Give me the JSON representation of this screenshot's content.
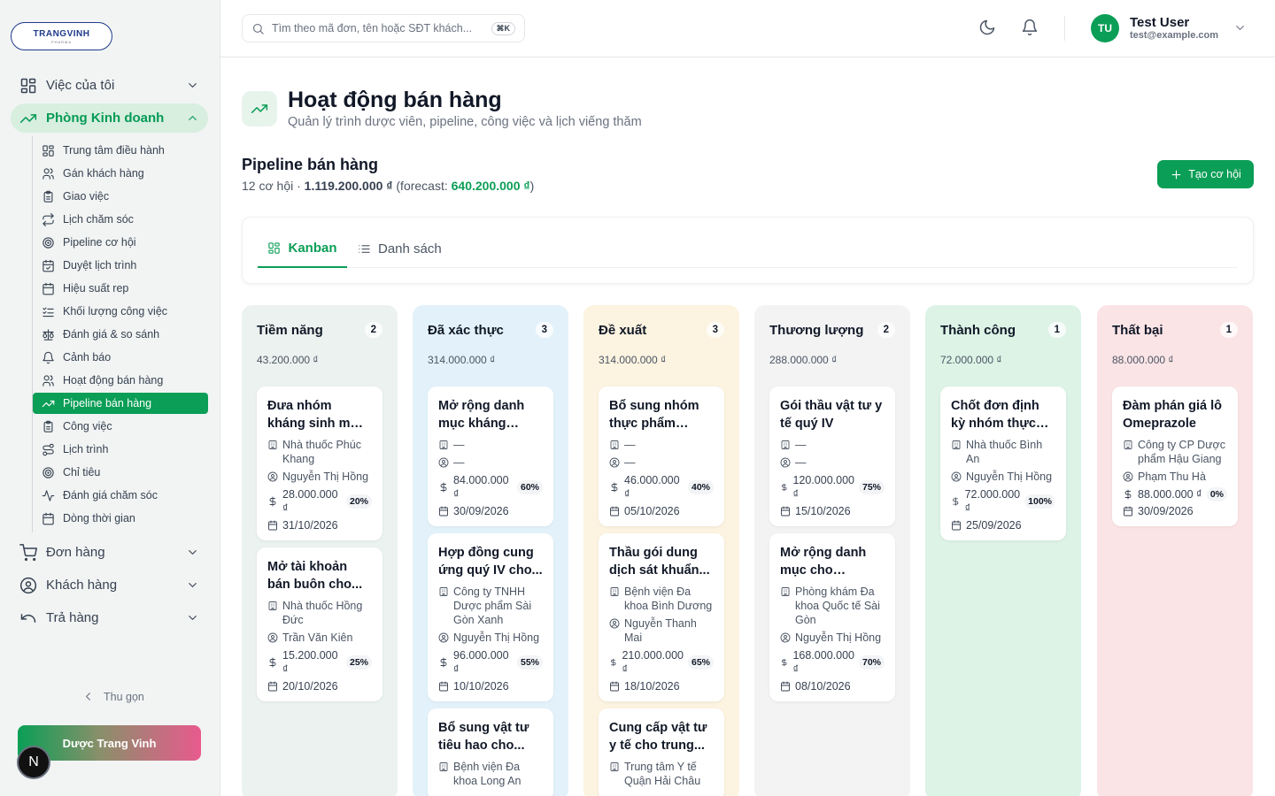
{
  "brand": {
    "logo_main": "TRANGVINH",
    "logo_sub": "PHARMA",
    "footer_name": "Dược Trang Vinh",
    "n_badge": "N"
  },
  "sidebar": {
    "groups": [
      {
        "label": "Việc của tôi"
      },
      {
        "label": "Phòng Kinh doanh"
      },
      {
        "label": "Đơn hàng"
      },
      {
        "label": "Khách hàng"
      },
      {
        "label": "Trả hàng"
      }
    ],
    "sub_items": [
      {
        "label": "Trung tâm điều hành"
      },
      {
        "label": "Gán khách hàng"
      },
      {
        "label": "Giao việc"
      },
      {
        "label": "Lịch chăm sóc"
      },
      {
        "label": "Pipeline cơ hội"
      },
      {
        "label": "Duyệt lịch trình"
      },
      {
        "label": "Hiệu suất rep"
      },
      {
        "label": "Khối lượng công việc"
      },
      {
        "label": "Đánh giá & so sánh"
      },
      {
        "label": "Cảnh báo"
      },
      {
        "label": "Hoạt động bán hàng"
      },
      {
        "label": "Pipeline bán hàng"
      },
      {
        "label": "Công việc"
      },
      {
        "label": "Lịch trình"
      },
      {
        "label": "Chỉ tiêu"
      },
      {
        "label": "Đánh giá chăm sóc"
      },
      {
        "label": "Dòng thời gian"
      }
    ],
    "collapse_label": "Thu gọn"
  },
  "header": {
    "search_placeholder": "Tìm theo mã đơn, tên hoặc SĐT khách...",
    "search_shortcut": "⌘K",
    "user_initials": "TU",
    "user_name": "Test User",
    "user_email": "test@example.com"
  },
  "page": {
    "title": "Hoạt động bán hàng",
    "subtitle": "Quản lý trình dược viên, pipeline, công việc và lịch viếng thăm",
    "section_title": "Pipeline bán hàng",
    "summary_prefix": "12 cơ hội · ",
    "summary_total": "1.119.200.000 ₫",
    "summary_mid": " (forecast: ",
    "summary_forecast": "640.200.000 ₫",
    "summary_suffix": ")",
    "create_button": "Tạo cơ hội",
    "tab_kanban": "Kanban",
    "tab_list": "Danh sách"
  },
  "colors": {
    "accent": "#0b9e56"
  },
  "columns": [
    {
      "title": "Tiềm năng",
      "count": "2",
      "total": "43.200.000 ₫",
      "bg": "#ebf2ef",
      "cards": [
        {
          "title": "Đưa nhóm kháng sinh mới vào...",
          "customer": "Nhà thuốc Phúc Khang",
          "rep": "Nguyễn Thị Hồng",
          "amount": "28.000.000 ₫",
          "pct": "20%",
          "date": "31/10/2026"
        },
        {
          "title": "Mở tài khoản bán buôn cho...",
          "customer": "Nhà thuốc Hồng Đức",
          "rep": "Trần Văn Kiên",
          "amount": "15.200.000 ₫",
          "pct": "25%",
          "date": "20/10/2026"
        }
      ]
    },
    {
      "title": "Đã xác thực",
      "count": "3",
      "total": "314.000.000 ₫",
      "bg": "#e3f2fa",
      "cards": [
        {
          "title": "Mở rộng danh mục kháng sinh...",
          "customer": "—",
          "rep": "—",
          "amount": "84.000.000 ₫",
          "pct": "60%",
          "date": "30/09/2026"
        },
        {
          "title": "Hợp đồng cung ứng quý IV cho...",
          "customer": "Công ty TNHH Dược phẩm Sài Gòn Xanh",
          "rep": "Nguyễn Thị Hồng",
          "amount": "96.000.000 ₫",
          "pct": "55%",
          "date": "10/10/2026"
        },
        {
          "title": "Bổ sung vật tư tiêu hao cho...",
          "customer": "Bệnh viện Đa khoa Long An",
          "rep": "",
          "amount": "",
          "pct": "",
          "date": ""
        }
      ]
    },
    {
      "title": "Đề xuất",
      "count": "3",
      "total": "314.000.000 ₫",
      "bg": "#fcf3e0",
      "cards": [
        {
          "title": "Bổ sung nhóm thực phẩm chứ...",
          "customer": "—",
          "rep": "—",
          "amount": "46.000.000 ₫",
          "pct": "40%",
          "date": "05/10/2026"
        },
        {
          "title": "Thầu gói dung dịch sát khuẩn...",
          "customer": "Bệnh viện Đa khoa Bình Dương",
          "rep": "Nguyễn Thanh Mai",
          "amount": "210.000.000 ₫",
          "pct": "65%",
          "date": "18/10/2026"
        },
        {
          "title": "Cung cấp vật tư y tế cho trung...",
          "customer": "Trung tâm Y tế Quận Hải Châu",
          "rep": "",
          "amount": "",
          "pct": "",
          "date": ""
        }
      ]
    },
    {
      "title": "Thương lượng",
      "count": "2",
      "total": "288.000.000 ₫",
      "bg": "#f3f3f4",
      "cards": [
        {
          "title": "Gói thầu vật tư y tế quý IV",
          "customer": "—",
          "rep": "—",
          "amount": "120.000.000 ₫",
          "pct": "75%",
          "date": "15/10/2026"
        },
        {
          "title": "Mở rộng danh mục cho phòng...",
          "customer": "Phòng khám Đa khoa Quốc tế Sài Gòn",
          "rep": "Nguyễn Thị Hồng",
          "amount": "168.000.000 ₫",
          "pct": "70%",
          "date": "08/10/2026"
        }
      ]
    },
    {
      "title": "Thành công",
      "count": "1",
      "total": "72.000.000 ₫",
      "bg": "#dcf3e6",
      "cards": [
        {
          "title": "Chốt đơn định kỳ nhóm thực phẩ...",
          "customer": "Nhà thuốc Bình An",
          "rep": "Nguyễn Thị Hồng",
          "amount": "72.000.000 ₫",
          "pct": "100%",
          "date": "25/09/2026"
        }
      ]
    },
    {
      "title": "Thất bại",
      "count": "1",
      "total": "88.000.000 ₫",
      "bg": "#fbe4e6",
      "cards": [
        {
          "title": "Đàm phán giá lô Omeprazole",
          "customer": "Công ty CP Dược phẩm Hậu Giang",
          "rep": "Phạm Thu Hà",
          "amount": "88.000.000 ₫",
          "pct": "0%",
          "date": "30/09/2026"
        }
      ]
    }
  ]
}
